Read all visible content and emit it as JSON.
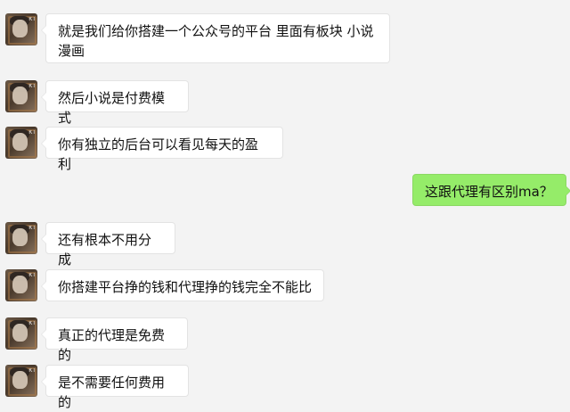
{
  "chat": {
    "avatar_badge": "KT",
    "messages": [
      {
        "side": "left",
        "text": "就是我们给你搭建一个公众号的平台 里面有板块 小说漫画"
      },
      {
        "side": "left",
        "text": "然后小说是付费模式"
      },
      {
        "side": "left",
        "text": "你有独立的后台可以看见每天的盈利"
      },
      {
        "side": "right",
        "text": "这跟代理有区别ma？"
      },
      {
        "side": "left",
        "text": "还有根本不用分成"
      },
      {
        "side": "left",
        "text": "你搭建平台挣的钱和代理挣的钱完全不能比"
      },
      {
        "side": "left",
        "text": "真正的代理是免费的"
      },
      {
        "side": "left",
        "text": "是不需要任何费用的"
      }
    ]
  }
}
